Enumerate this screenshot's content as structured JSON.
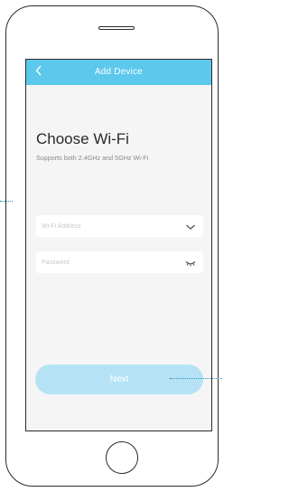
{
  "header": {
    "title": "Add Device"
  },
  "main": {
    "title": "Choose Wi-Fi",
    "subtitle": "Supports both 2.4GHz and 5GHz Wi-Fi"
  },
  "form": {
    "wifi_address_placeholder": "Wi-Fi Address",
    "password_placeholder": "Password"
  },
  "actions": {
    "next_label": "Next"
  },
  "colors": {
    "accent": "#5bc8ec",
    "button_disabled": "#b5e3f5",
    "callout": "#2f8fbf"
  },
  "icons": {
    "back": "chevron-left-icon",
    "dropdown": "chevron-down-icon",
    "password_visibility": "eye-closed-icon",
    "home": "home-button"
  }
}
